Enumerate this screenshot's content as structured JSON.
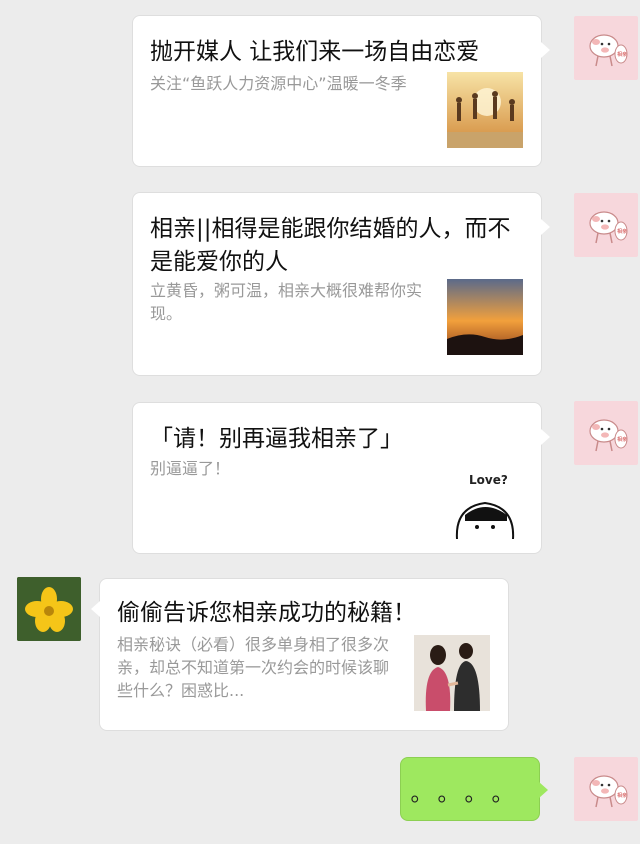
{
  "messages": [
    {
      "title": "抛开媒人 让我们来一场自由恋爱",
      "desc": "关注“鱼跃人力资源中心”温暖一冬季"
    },
    {
      "title": "相亲||相得是能跟你结婚的人，而不是能爱你的人",
      "desc": "立黄昏，粥可温，相亲大概很难帮你实现。"
    },
    {
      "title": "「请！别再逼我相亲了」",
      "desc": "别逼逼了！",
      "thumb_text": "Love?"
    },
    {
      "title": "偷偷告诉您相亲成功的秘籍！",
      "desc": "相亲秘诀（必看）很多单身相了很多次亲，却总不知道第一次约会的时候该聊些什么？困惑比..."
    }
  ],
  "reply": {
    "text": "。。。。"
  },
  "colors": {
    "background": "#ececec",
    "sent_bubble": "#9ee85f",
    "card": "#ffffff"
  },
  "icons": {
    "self_avatar": "pig-avatar-icon",
    "other_avatar": "flower-avatar-icon"
  }
}
